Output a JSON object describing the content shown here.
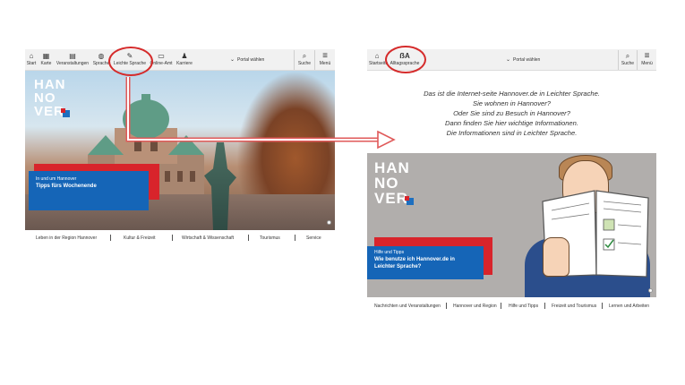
{
  "left": {
    "nav": [
      {
        "label": "Start",
        "icon": "home-icon",
        "glyph": "⌂"
      },
      {
        "label": "Karte",
        "icon": "map-icon",
        "glyph": "▦"
      },
      {
        "label": "Veranstaltungen",
        "icon": "calendar-icon",
        "glyph": "▤"
      },
      {
        "label": "Sprache",
        "icon": "globe-icon",
        "glyph": "◍"
      },
      {
        "label": "Leichte Sprache",
        "icon": "easy-language-icon",
        "glyph": "✎"
      },
      {
        "label": "Online-Amt",
        "icon": "id-card-icon",
        "glyph": "▭"
      },
      {
        "label": "Karriere",
        "icon": "people-icon",
        "glyph": "♟"
      }
    ],
    "portal_label": "Portal wählen",
    "search_label": "Suche",
    "menu_label": "Menü",
    "logo": [
      "HAN",
      "NO",
      "VER"
    ],
    "teaser_small": "In und um Hannover",
    "teaser_big": "Tipps fürs Wochenende",
    "bottom_nav": [
      "Leben in der Region Hannover",
      "Kultur & Freizeit",
      "Wirtschaft & Wissenschaft",
      "Tourismus",
      "Service"
    ]
  },
  "right": {
    "nav": [
      {
        "label": "Startseite",
        "icon": "home-icon",
        "glyph": "⌂"
      },
      {
        "label": "Alltagssprache",
        "icon": "everyday-language-icon",
        "glyph": "ẞA"
      }
    ],
    "portal_label": "Portal wählen",
    "search_label": "Suche",
    "menu_label": "Menü",
    "intro": [
      "Das ist die Internet-seite Hannover.de in Leichter Sprache.",
      "Sie wohnen in Hannover?",
      "Oder Sie sind zu Besuch in Hannover?",
      "Dann finden Sie hier wichtige Informationen.",
      "Die Informationen sind in Leichter Sprache."
    ],
    "logo": [
      "HAN",
      "NO",
      "VER"
    ],
    "teaser_small": "Hilfe und Tipps",
    "teaser_big": "Wie benutze ich Hannover.de in Leichter Sprache?",
    "bottom_nav": [
      "Nachrichten und Veranstaltungen",
      "Hannover und Region",
      "Hilfe und Tipps",
      "Freizeit und Tourismus",
      "Lernen und Arbeiten"
    ]
  },
  "colors": {
    "highlight": "#d52b2b",
    "teaser_blue": "#1565b7",
    "teaser_red": "#d8242b",
    "arrow": "#e05a5a"
  }
}
